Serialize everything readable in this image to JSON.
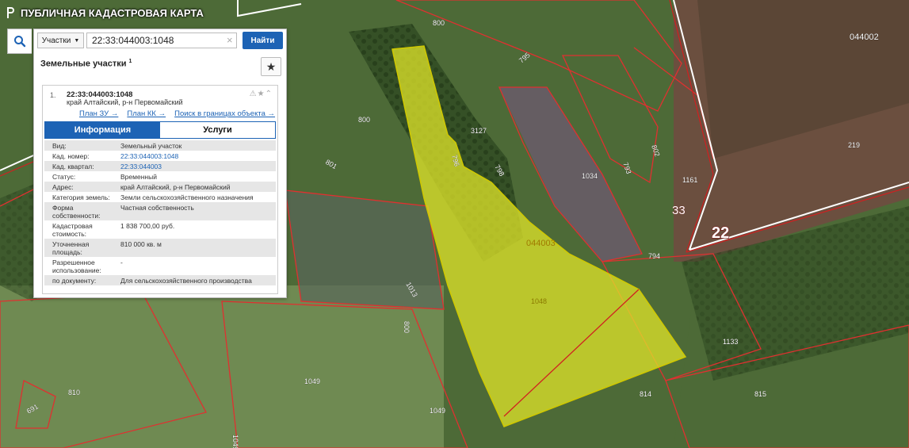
{
  "app": {
    "title": "ПУБЛИЧНАЯ КАДАСТРОВАЯ КАРТА"
  },
  "search": {
    "category": "Участки",
    "query": "22:33:044003:1048",
    "button": "Найти"
  },
  "results": {
    "title": "Земельные участки",
    "count": "1"
  },
  "parcel": {
    "index": "1.",
    "cad_number": "22:33:044003:1048",
    "address_short": "край Алтайский, р-н Первомайский",
    "links": [
      "План ЗУ →",
      "План КК →",
      "Поиск в границах объекта →"
    ],
    "tabs": [
      "Информация",
      "Услуги"
    ],
    "attributes": [
      {
        "label": "Вид:",
        "value": "Земельный участок",
        "link": false
      },
      {
        "label": "Кад. номер:",
        "value": "22:33:044003:1048",
        "link": true
      },
      {
        "label": "Кад. квартал:",
        "value": "22:33:044003",
        "link": true
      },
      {
        "label": "Статус:",
        "value": "Временный",
        "link": false
      },
      {
        "label": "Адрес:",
        "value": "край Алтайский, р-н Первомайский",
        "link": false
      },
      {
        "label": "Категория земель:",
        "value": "Земли сельскохозяйственного назначения",
        "link": false
      },
      {
        "label": "Форма собственности:",
        "value": "Частная собственность",
        "link": false
      },
      {
        "label": "Кадастровая стоимость:",
        "value": "1 838 700,00 руб.",
        "link": false
      },
      {
        "label": "Уточненная площадь:",
        "value": "810 000 кв. м",
        "link": false
      },
      {
        "label": "Разрешенное использование:",
        "value": "-",
        "link": false
      },
      {
        "label": "по документу:",
        "value": "Для сельскохозяйственного производства",
        "link": false
      }
    ]
  },
  "map": {
    "colors": {
      "boundary": "#e03030",
      "selected_fill": "#e0e62a",
      "road": "#ffffff"
    },
    "labels": {
      "l800a": "800",
      "l800b": "800",
      "l800c": "800",
      "l044002": "044002",
      "l044003": "044003",
      "l1048": "1048",
      "l1034": "1034",
      "l1161": "1161",
      "l219": "219",
      "l33": "33",
      "l22": "22",
      "l3127": "3127",
      "l1133": "1133",
      "l1049a": "1049",
      "l1049b": "1049",
      "l814": "814",
      "l815": "815",
      "l810": "810",
      "l691": "691",
      "l801": "801",
      "l794": "794",
      "l1013": "1013",
      "l796": "796",
      "l798": "798",
      "l795": "795",
      "l793": "793",
      "l802": "802"
    }
  }
}
